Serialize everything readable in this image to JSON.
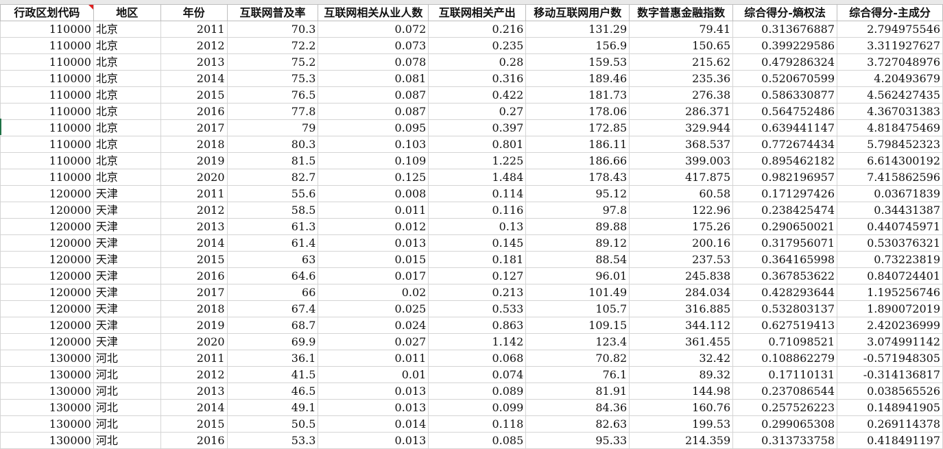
{
  "sheet": {
    "columns": [
      "行政区划代码",
      "地区",
      "年份",
      "互联网普及率",
      "互联网相关从业人数",
      "互联网相关产出",
      "移动互联网用户数",
      "数字普惠金融指数",
      "综合得分-熵权法",
      "综合得分-主成分"
    ],
    "rows": [
      [
        "110000",
        "北京",
        "2011",
        "70.3",
        "0.072",
        "0.216",
        "131.29",
        "79.41",
        "0.313676887",
        "2.794975546"
      ],
      [
        "110000",
        "北京",
        "2012",
        "72.2",
        "0.073",
        "0.235",
        "156.9",
        "150.65",
        "0.399229586",
        "3.311927627"
      ],
      [
        "110000",
        "北京",
        "2013",
        "75.2",
        "0.078",
        "0.28",
        "159.53",
        "215.62",
        "0.479286324",
        "3.727048976"
      ],
      [
        "110000",
        "北京",
        "2014",
        "75.3",
        "0.081",
        "0.316",
        "189.46",
        "235.36",
        "0.520670599",
        "4.20493679"
      ],
      [
        "110000",
        "北京",
        "2015",
        "76.5",
        "0.087",
        "0.422",
        "181.73",
        "276.38",
        "0.586330877",
        "4.562427435"
      ],
      [
        "110000",
        "北京",
        "2016",
        "77.8",
        "0.087",
        "0.27",
        "178.06",
        "286.371",
        "0.564752486",
        "4.367031383"
      ],
      [
        "110000",
        "北京",
        "2017",
        "79",
        "0.095",
        "0.397",
        "172.85",
        "329.944",
        "0.639441147",
        "4.818475469"
      ],
      [
        "110000",
        "北京",
        "2018",
        "80.3",
        "0.103",
        "0.801",
        "186.11",
        "368.537",
        "0.772674434",
        "5.798452323"
      ],
      [
        "110000",
        "北京",
        "2019",
        "81.5",
        "0.109",
        "1.225",
        "186.66",
        "399.003",
        "0.895462182",
        "6.614300192"
      ],
      [
        "110000",
        "北京",
        "2020",
        "82.7",
        "0.125",
        "1.484",
        "178.43",
        "417.875",
        "0.982196957",
        "7.415862596"
      ],
      [
        "120000",
        "天津",
        "2011",
        "55.6",
        "0.008",
        "0.114",
        "95.12",
        "60.58",
        "0.171297426",
        "0.03671839"
      ],
      [
        "120000",
        "天津",
        "2012",
        "58.5",
        "0.011",
        "0.116",
        "97.8",
        "122.96",
        "0.238425474",
        "0.34431387"
      ],
      [
        "120000",
        "天津",
        "2013",
        "61.3",
        "0.012",
        "0.13",
        "89.88",
        "175.26",
        "0.290650021",
        "0.440745971"
      ],
      [
        "120000",
        "天津",
        "2014",
        "61.4",
        "0.013",
        "0.145",
        "89.12",
        "200.16",
        "0.317956071",
        "0.530376321"
      ],
      [
        "120000",
        "天津",
        "2015",
        "63",
        "0.015",
        "0.181",
        "88.54",
        "237.53",
        "0.364165998",
        "0.73223819"
      ],
      [
        "120000",
        "天津",
        "2016",
        "64.6",
        "0.017",
        "0.127",
        "96.01",
        "245.838",
        "0.367853622",
        "0.840724401"
      ],
      [
        "120000",
        "天津",
        "2017",
        "66",
        "0.02",
        "0.213",
        "101.49",
        "284.034",
        "0.428293644",
        "1.195256746"
      ],
      [
        "120000",
        "天津",
        "2018",
        "67.4",
        "0.025",
        "0.533",
        "105.7",
        "316.885",
        "0.532803137",
        "1.890072019"
      ],
      [
        "120000",
        "天津",
        "2019",
        "68.7",
        "0.024",
        "0.863",
        "109.15",
        "344.112",
        "0.627519413",
        "2.420236999"
      ],
      [
        "120000",
        "天津",
        "2020",
        "69.9",
        "0.027",
        "1.142",
        "123.4",
        "361.455",
        "0.71098521",
        "3.074991142"
      ],
      [
        "130000",
        "河北",
        "2011",
        "36.1",
        "0.011",
        "0.068",
        "70.82",
        "32.42",
        "0.108862279",
        "-0.571948305"
      ],
      [
        "130000",
        "河北",
        "2012",
        "41.5",
        "0.01",
        "0.074",
        "76.1",
        "89.32",
        "0.17110131",
        "-0.314136817"
      ],
      [
        "130000",
        "河北",
        "2013",
        "46.5",
        "0.013",
        "0.089",
        "81.91",
        "144.98",
        "0.237086544",
        "0.038565526"
      ],
      [
        "130000",
        "河北",
        "2014",
        "49.1",
        "0.013",
        "0.099",
        "84.36",
        "160.76",
        "0.257526223",
        "0.148941905"
      ],
      [
        "130000",
        "河北",
        "2015",
        "50.5",
        "0.014",
        "0.118",
        "82.63",
        "199.53",
        "0.299065308",
        "0.269114378"
      ],
      [
        "130000",
        "河北",
        "2016",
        "53.3",
        "0.013",
        "0.085",
        "95.33",
        "214.359",
        "0.313733758",
        "0.418491197"
      ]
    ]
  }
}
